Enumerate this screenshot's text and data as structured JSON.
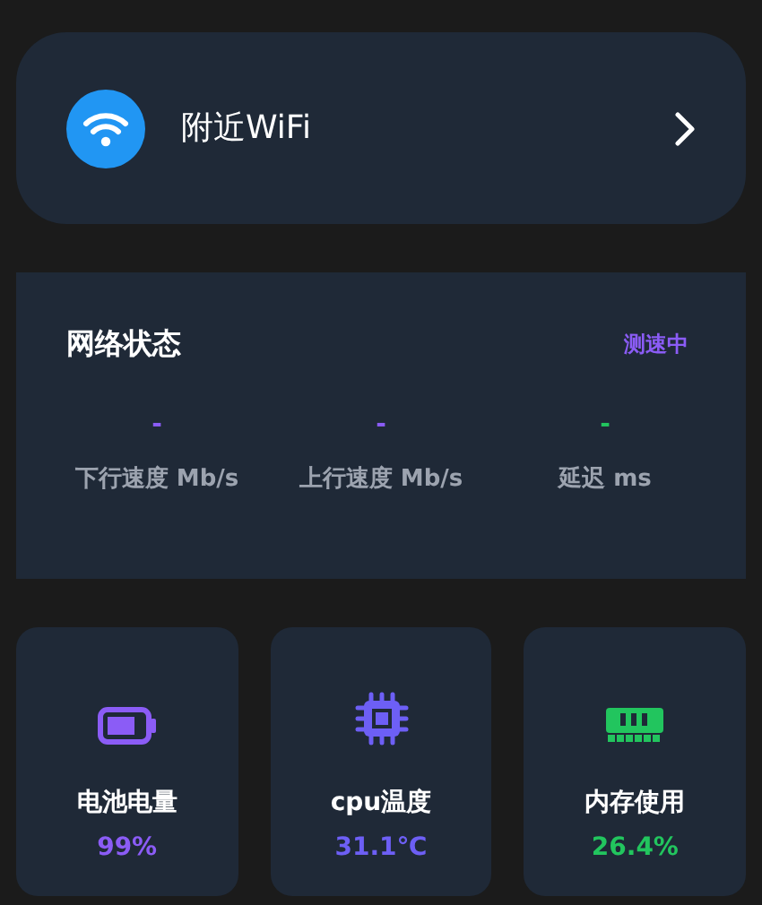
{
  "wifi_entry": {
    "label": "附近WiFi"
  },
  "network_status": {
    "title": "网络状态",
    "status": "测速中",
    "metrics": [
      {
        "value": "-",
        "label": "下行速度 Mb/s",
        "color": "#8b5cf6"
      },
      {
        "value": "-",
        "label": "上行速度 Mb/s",
        "color": "#8b5cf6"
      },
      {
        "value": "-",
        "label": "延迟 ms",
        "color": "#22c55e"
      }
    ]
  },
  "tiles": [
    {
      "kind": "battery",
      "label": "电池电量",
      "value": "99%",
      "color": "#8b5cf6"
    },
    {
      "kind": "cpu",
      "label": "cpu温度",
      "value": "31.1℃",
      "color": "#6d5ff5"
    },
    {
      "kind": "memory",
      "label": "内存使用",
      "value": "26.4%",
      "color": "#22c55e"
    }
  ]
}
